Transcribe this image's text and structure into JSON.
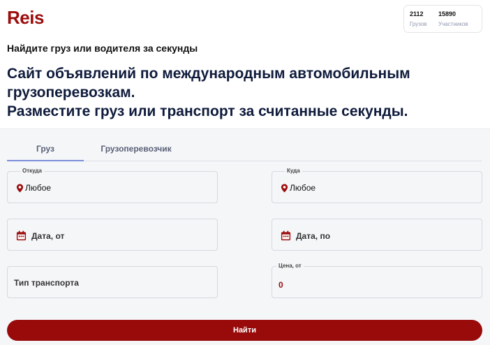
{
  "brand": {
    "logo": "Reis",
    "color": "#9c0c0c"
  },
  "stats": [
    {
      "value": "2112",
      "label": "Грузов"
    },
    {
      "value": "15890",
      "label": "Участников"
    }
  ],
  "tagline": "Найдите груз или водителя за секунды",
  "headline": {
    "line1": "Сайт объявлений по международным автомобильным",
    "line2": "грузоперевозкам.",
    "line3": "Разместите груз или транспорт за считанные секунды."
  },
  "tabs": [
    {
      "label": "Груз",
      "active": true
    },
    {
      "label": "Грузоперевозчик",
      "active": false
    }
  ],
  "form": {
    "from": {
      "label": "Откуда",
      "value": "Любое",
      "icon": "map-pin-icon"
    },
    "to": {
      "label": "Куда",
      "value": "Любое",
      "icon": "map-pin-icon"
    },
    "date_from": {
      "value": "Дата, от",
      "icon": "calendar-icon"
    },
    "date_to": {
      "value": "Дата, по",
      "icon": "calendar-icon"
    },
    "transport_type": {
      "value": "Тип транспорта"
    },
    "price_from": {
      "label": "Цена, от",
      "value": "0"
    },
    "submit_label": "Найти"
  },
  "colors": {
    "accent": "#990b0b",
    "tab_indicator": "#7b8fd8",
    "headline": "#0f1b3c"
  }
}
